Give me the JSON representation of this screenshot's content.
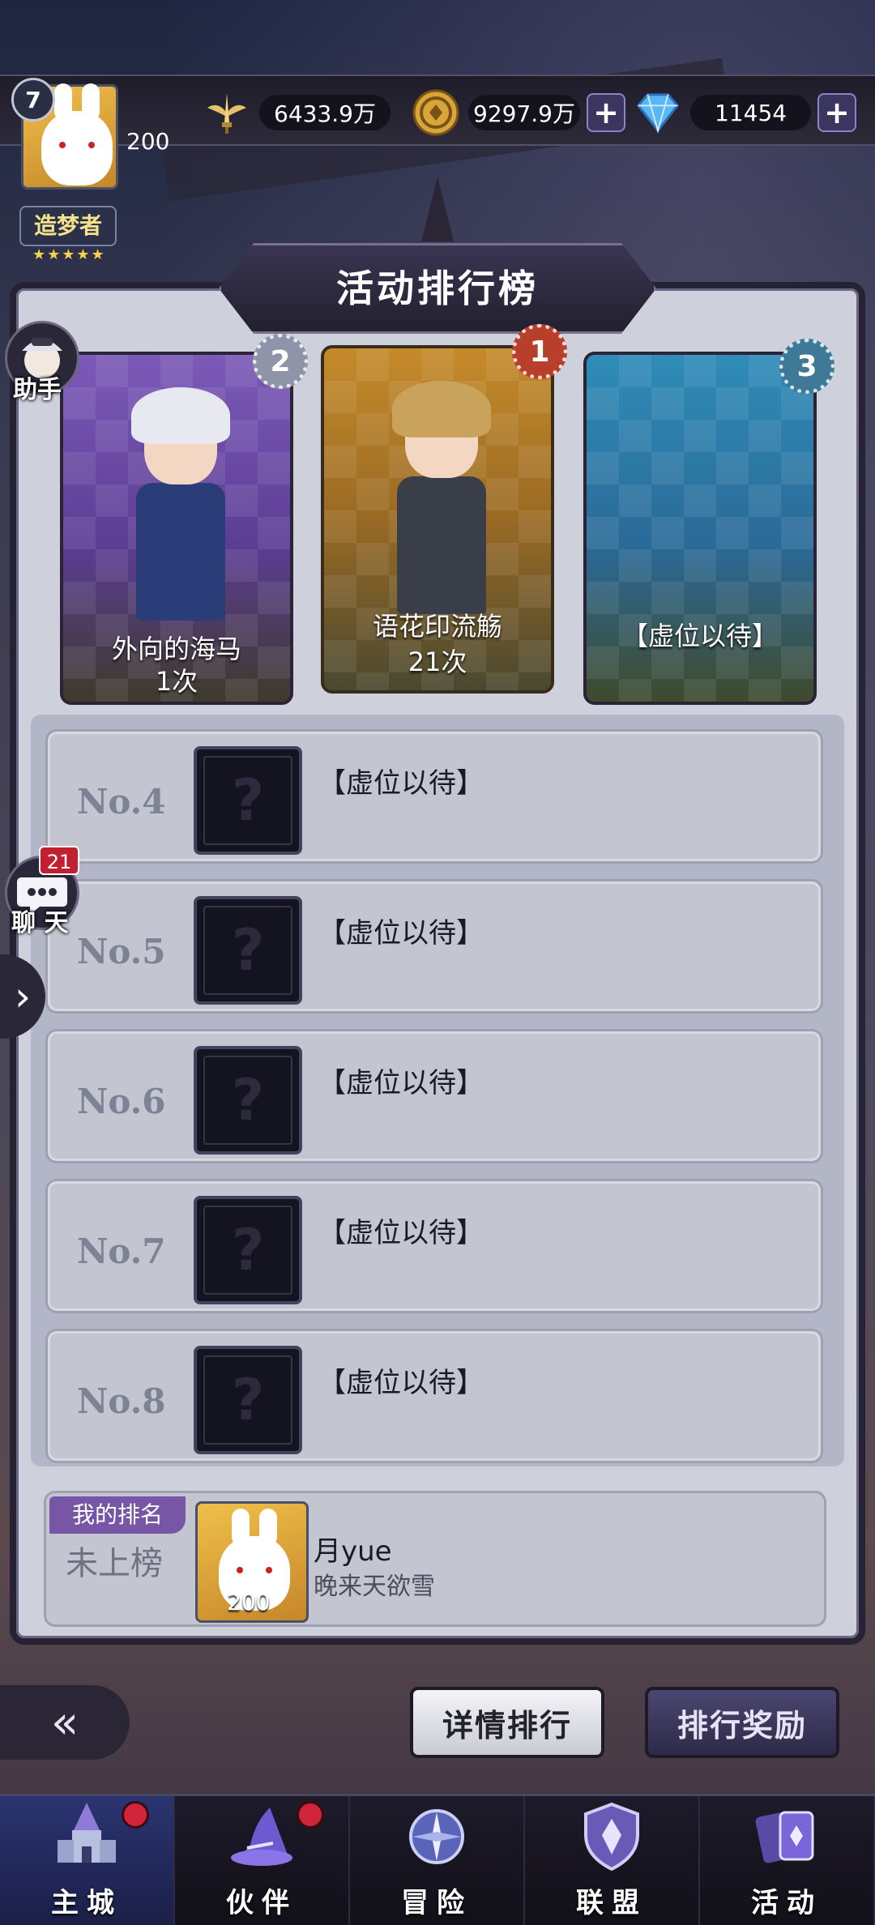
{
  "resources": {
    "power": "6433.9万",
    "gold": "9297.9万",
    "gems": "11454"
  },
  "player": {
    "level": "7",
    "avatar_number": "200",
    "title": "造梦者",
    "title_stars": "★★★★★"
  },
  "side": {
    "assistant_label": "助手",
    "chat_label": "聊 天",
    "chat_badge": "21"
  },
  "panel": {
    "title": "活动排行榜"
  },
  "podium": [
    {
      "rank": "2",
      "name": "外向的海马",
      "count": "1次"
    },
    {
      "rank": "1",
      "name": "语花印流觞",
      "count": "21次"
    },
    {
      "rank": "3",
      "name": "【虚位以待】",
      "count": ""
    }
  ],
  "list": [
    {
      "no": "No.4",
      "name": "【虚位以待】"
    },
    {
      "no": "No.5",
      "name": "【虚位以待】"
    },
    {
      "no": "No.6",
      "name": "【虚位以待】"
    },
    {
      "no": "No.7",
      "name": "【虚位以待】"
    },
    {
      "no": "No.8",
      "name": "【虚位以待】"
    }
  ],
  "my_rank": {
    "tag": "我的排名",
    "status": "未上榜",
    "avatar_number": "200",
    "name": "月yue",
    "guild": "晚来天欲雪"
  },
  "actions": {
    "detail": "详情排行",
    "reward": "排行奖励"
  },
  "nav": [
    {
      "label": "主城",
      "dot": true,
      "active": true
    },
    {
      "label": "伙伴",
      "dot": true,
      "active": false
    },
    {
      "label": "冒险",
      "dot": false,
      "active": false
    },
    {
      "label": "联盟",
      "dot": false,
      "active": false
    },
    {
      "label": "活动",
      "dot": false,
      "active": false
    }
  ],
  "colors": {
    "accent_purple": "#7756a6",
    "badge_red": "#d0243a",
    "gold_card": "#c58a2a",
    "silver_card": "#7c5ab8",
    "blue_card": "#2f8cb8"
  }
}
